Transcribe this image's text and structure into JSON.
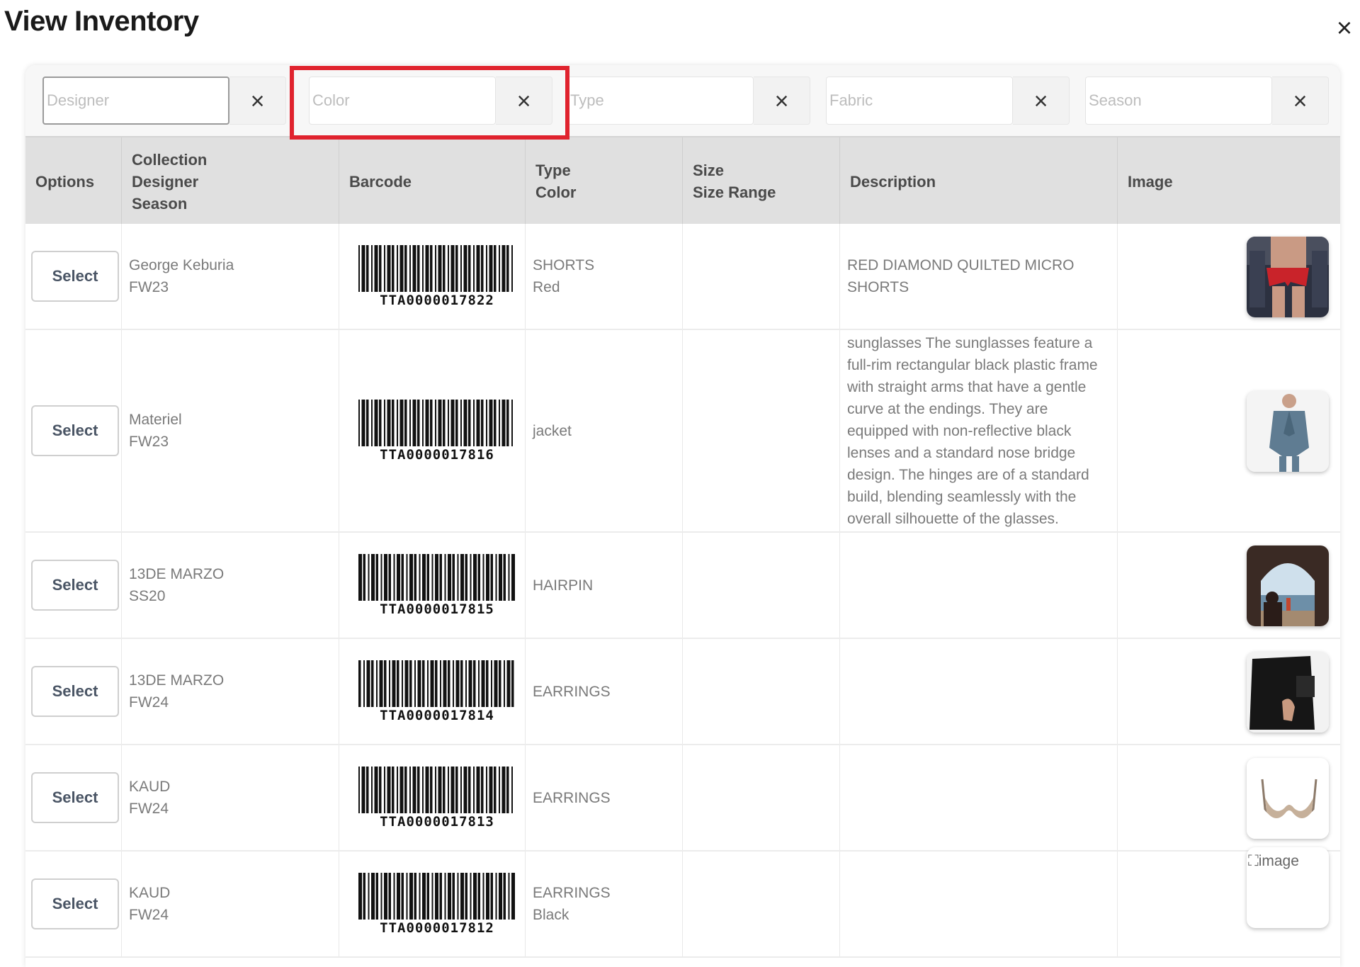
{
  "modal": {
    "title": "View Inventory",
    "close_glyph": "×"
  },
  "filters": [
    {
      "placeholder": "Designer",
      "clear_glyph": "×"
    },
    {
      "placeholder": "Color",
      "clear_glyph": "×"
    },
    {
      "placeholder": "Type",
      "clear_glyph": "×"
    },
    {
      "placeholder": "Fabric",
      "clear_glyph": "×"
    },
    {
      "placeholder": "Season",
      "clear_glyph": "×"
    }
  ],
  "columns": {
    "options": "Options",
    "collection": [
      "Collection",
      "Designer",
      "Season"
    ],
    "barcode": "Barcode",
    "type_color": [
      "Type",
      "Color"
    ],
    "size": [
      "Size",
      "Size Range"
    ],
    "description": "Description",
    "image": "Image"
  },
  "rows": [
    {
      "select_label": "Select",
      "designer": "George Keburia",
      "season": "FW23",
      "barcode": "TTA0000017822",
      "type": "SHORTS",
      "color": "Red",
      "description": "RED DIAMOND QUILTED MICRO SHORTS",
      "image": "red-shorts-photo",
      "image_alt": ""
    },
    {
      "select_label": "Select",
      "designer": "Materiel",
      "season": "FW23",
      "barcode": "TTA0000017816",
      "type": "jacket",
      "color": "",
      "description": "sunglasses The sunglasses feature a full-rim rectangular black plastic frame with straight arms that have a gentle curve at the endings. They are equipped with non-reflective black lenses and a standard nose bridge design. The hinges are of a standard build, blending seamlessly with the overall silhouette of the glasses.",
      "image": "blue-jacket-photo",
      "image_alt": ""
    },
    {
      "select_label": "Select",
      "designer": "13DE MARZO",
      "season": "SS20",
      "barcode": "TTA0000017815",
      "type": "HAIRPIN",
      "color": "",
      "description": "",
      "image": "arch-seaside-photo",
      "image_alt": ""
    },
    {
      "select_label": "Select",
      "designer": "13DE MARZO",
      "season": "FW24",
      "barcode": "TTA0000017814",
      "type": "EARRINGS",
      "color": "",
      "description": "",
      "image": "dark-earrings-photo",
      "image_alt": ""
    },
    {
      "select_label": "Select",
      "designer": "KAUD",
      "season": "FW24",
      "barcode": "TTA0000017813",
      "type": "EARRINGS",
      "color": "",
      "description": "",
      "image": "bra-photo",
      "image_alt": ""
    },
    {
      "select_label": "Select",
      "designer": "KAUD",
      "season": "FW24",
      "barcode": "TTA0000017812",
      "type": "EARRINGS",
      "color": "Black",
      "description": "",
      "image": "broken-image",
      "image_alt": "image"
    }
  ],
  "colors": {
    "highlight": "#e0232e",
    "header_bg": "#e0e0e0",
    "button_text": "#4a5565"
  }
}
